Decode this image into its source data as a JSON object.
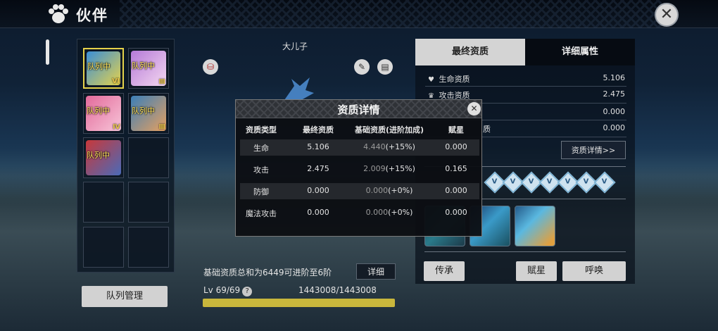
{
  "header": {
    "title": "伙伴"
  },
  "grid": {
    "slots": [
      {
        "tag": "队列中",
        "rank": "Ⅵ",
        "colors": [
          "#3a8ed6",
          "#e5d24c"
        ]
      },
      {
        "tag": "队列中",
        "rank": "Ⅲ",
        "colors": [
          "#b57ad8",
          "#f4d7f0"
        ]
      },
      {
        "tag": "队列中",
        "rank": "Ⅳ",
        "colors": [
          "#e36a9a",
          "#f7c4d8"
        ]
      },
      {
        "tag": "队列中",
        "rank": "Ⅲ",
        "colors": [
          "#3b7fb8",
          "#e6a060"
        ]
      },
      {
        "tag": "队列中",
        "rank": "",
        "colors": [
          "#c8383a",
          "#4a6ab8"
        ]
      }
    ],
    "queue_button": "队列管理"
  },
  "partner": {
    "name": "大儿子",
    "base_total_info": "基础资质总和为6449可进阶至6阶",
    "detail_button": "详细",
    "level": "Lv 69/69",
    "help_icon": "?",
    "exp": "1443008/1443008",
    "exp_fraction": 1.0
  },
  "right": {
    "tabs": [
      "最终资质",
      "详细属性"
    ],
    "stats": [
      {
        "icon": "heart-icon",
        "label": "生命资质",
        "value": "5.106"
      },
      {
        "icon": "crown-icon",
        "label": "攻击资质",
        "value": "2.475"
      },
      {
        "icon": "",
        "label": "",
        "value": "0.000"
      },
      {
        "icon": "",
        "label": "质",
        "value": "0.000"
      }
    ],
    "quality_detail_button": "资质详情>>",
    "star_count": 7,
    "buttons": {
      "inherit": "传承",
      "star": "赋星",
      "summon": "呼唤"
    }
  },
  "modal": {
    "title": "资质详情",
    "headers": [
      "资质类型",
      "最终资质",
      "基础资质(进阶加成)",
      "赋星"
    ],
    "rows": [
      {
        "type": "生命",
        "final": "5.106",
        "base": "4.440",
        "bonus": "(+15%)",
        "star": "0.000"
      },
      {
        "type": "攻击",
        "final": "2.475",
        "base": "2.009",
        "bonus": "(+15%)",
        "star": "0.165"
      },
      {
        "type": "防御",
        "final": "0.000",
        "base": "0.000",
        "bonus": "(+0%)",
        "star": "0.000"
      },
      {
        "type": "魔法攻击",
        "final": "0.000",
        "base": "0.000",
        "bonus": "(+0%)",
        "star": "0.000"
      }
    ]
  }
}
